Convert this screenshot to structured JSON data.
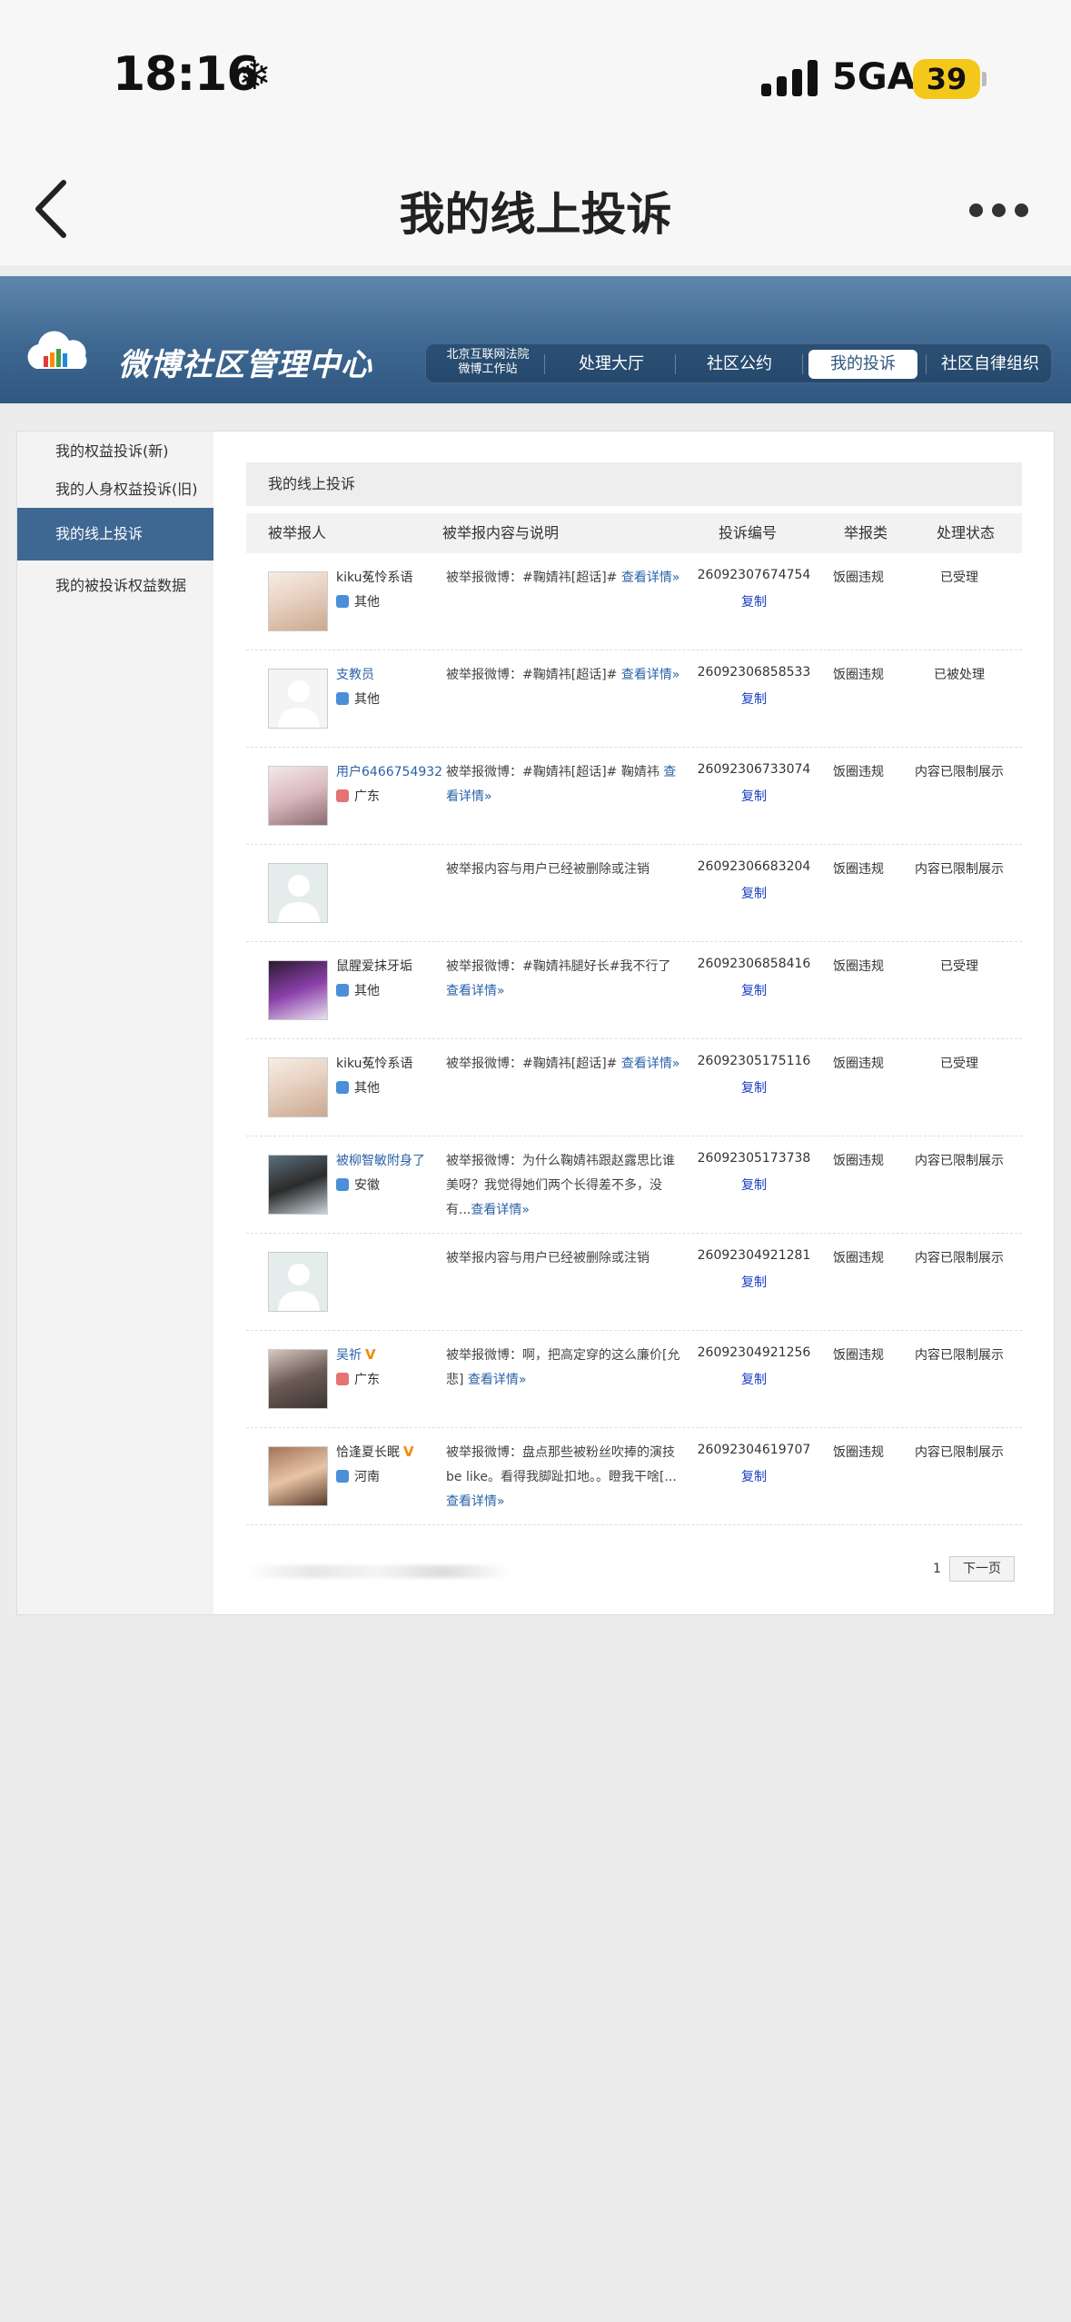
{
  "status": {
    "time": "18:16",
    "network": "5GA",
    "battery": "39"
  },
  "nav": {
    "title": "我的线上投诉"
  },
  "banner": {
    "title": "微博社区管理中心",
    "court_line1": "北京互联网法院",
    "court_line2": "微博工作站",
    "tabs": [
      "处理大厅",
      "社区公约",
      "我的投诉",
      "社区自律组织"
    ]
  },
  "sidebar": {
    "items": [
      "我的权益投诉(新)",
      "我的人身权益投诉(旧)",
      "我的线上投诉",
      "我的被投诉权益数据"
    ]
  },
  "main": {
    "box_title": "我的线上投诉",
    "headers": {
      "reported": "被举报人",
      "content": "被举报内容与说明",
      "id": "投诉编号",
      "type": "举报类",
      "status": "处理状态"
    },
    "copy_label": "复制",
    "rows": [
      {
        "name": "kiku菟怜系语",
        "loc": "其他",
        "desc": "被举报微博：#鞠婧祎[超话]# ",
        "more": "查看详情»",
        "id": "26092307674754",
        "type": "饭圈违规",
        "status": "已受理"
      },
      {
        "name": "支教员",
        "loc": "其他",
        "desc": "被举报微博：#鞠婧祎[超话]# ",
        "more": "查看详情»",
        "id": "26092306858533",
        "type": "饭圈违规",
        "status": "已被处理"
      },
      {
        "name": "用户6466754932",
        "loc": "广东",
        "desc": "被举报微博：#鞠婧祎[超话]# 鞠婧祎 ",
        "more": "查看详情»",
        "id": "26092306733074",
        "type": "饭圈违规",
        "status": "内容已限制展示"
      },
      {
        "name": "",
        "loc": "",
        "desc": "被举报内容与用户已经被删除或注销",
        "more": "",
        "id": "26092306683204",
        "type": "饭圈违规",
        "status": "内容已限制展示"
      },
      {
        "name": "鼠腥爱抹牙垢",
        "loc": "其他",
        "desc": "被举报微博：#鞠婧祎腿好长#我不行了 ",
        "more": "查看详情»",
        "id": "26092306858416",
        "type": "饭圈违规",
        "status": "已受理"
      },
      {
        "name": "kiku菟怜系语",
        "loc": "其他",
        "desc": "被举报微博：#鞠婧祎[超话]# ",
        "more": "查看详情»",
        "id": "26092305175116",
        "type": "饭圈违规",
        "status": "已受理"
      },
      {
        "name": "被柳智敏附身了",
        "loc": "安徽",
        "desc": "被举报微博：为什么鞠婧祎跟赵露思比谁美呀？我觉得她们两个长得差不多，没有...",
        "more": "查看详情»",
        "id": "26092305173738",
        "type": "饭圈违规",
        "status": "内容已限制展示"
      },
      {
        "name": "",
        "loc": "",
        "desc": "被举报内容与用户已经被删除或注销",
        "more": "",
        "id": "26092304921281",
        "type": "饭圈违规",
        "status": "内容已限制展示"
      },
      {
        "name": "吴祈",
        "loc": "广东",
        "desc": "被举报微博：啊，把高定穿的这么廉价[允悲] ",
        "more": "查看详情»",
        "id": "26092304921256",
        "type": "饭圈违规",
        "status": "内容已限制展示"
      },
      {
        "name": "恰逢夏长眠",
        "loc": "河南",
        "desc": "被举报微博：盘点那些被粉丝吹捧的演技be like。看得我脚趾扣地。。瞪我干啥[...",
        "more": "查看详情»",
        "id": "26092304619707",
        "type": "饭圈违规",
        "status": "内容已限制展示"
      }
    ]
  },
  "pager": {
    "page": "1",
    "next": "下一页"
  }
}
